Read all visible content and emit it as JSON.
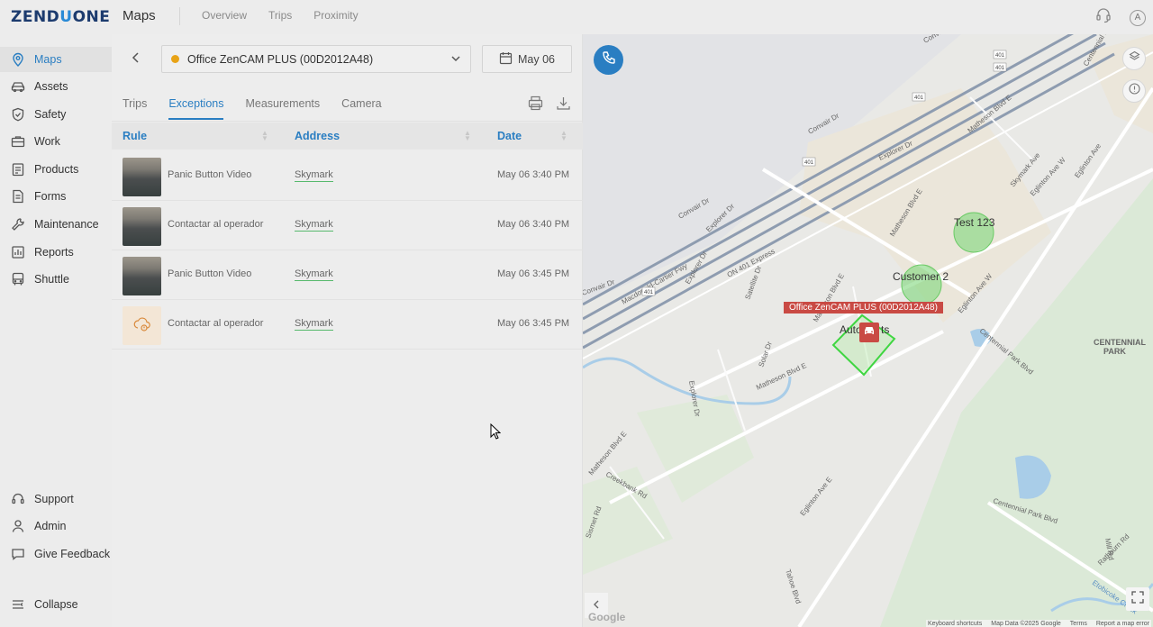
{
  "topbar": {
    "logo_a": "ZEND",
    "logo_b": "U",
    "logo_c": "ONE",
    "title": "Maps",
    "nav": [
      "Overview",
      "Trips",
      "Proximity"
    ],
    "avatar": "A"
  },
  "sidebar": {
    "items": [
      {
        "label": "Maps",
        "icon": "map-pin-icon",
        "active": true
      },
      {
        "label": "Assets",
        "icon": "car-icon"
      },
      {
        "label": "Safety",
        "icon": "shield-icon"
      },
      {
        "label": "Work",
        "icon": "briefcase-icon"
      },
      {
        "label": "Products",
        "icon": "clipboard-icon"
      },
      {
        "label": "Forms",
        "icon": "document-icon"
      },
      {
        "label": "Maintenance",
        "icon": "wrench-icon"
      },
      {
        "label": "Reports",
        "icon": "bar-chart-icon"
      },
      {
        "label": "Shuttle",
        "icon": "bus-icon"
      }
    ],
    "bottom": [
      {
        "label": "Support",
        "icon": "headset-icon"
      },
      {
        "label": "Admin",
        "icon": "person-icon"
      },
      {
        "label": "Give Feedback",
        "icon": "chat-icon"
      }
    ],
    "collapse": "Collapse"
  },
  "panel": {
    "device": "Office ZenCAM PLUS (00D2012A48)",
    "device_status_color": "#e8a317",
    "date": "May 06",
    "tabs": [
      {
        "label": "Trips"
      },
      {
        "label": "Exceptions",
        "active": true
      },
      {
        "label": "Measurements"
      },
      {
        "label": "Camera"
      }
    ],
    "columns": {
      "rule": "Rule",
      "address": "Address",
      "date": "Date"
    },
    "rows": [
      {
        "rule": "Panic Button Video",
        "address": "Skymark",
        "date": "May 06 3:40 PM",
        "thumb": "video"
      },
      {
        "rule": "Contactar al operador",
        "address": "Skymark",
        "date": "May 06 3:40 PM",
        "thumb": "video"
      },
      {
        "rule": "Panic Button Video",
        "address": "Skymark",
        "date": "May 06 3:45 PM",
        "thumb": "video"
      },
      {
        "rule": "Contactar al operador",
        "address": "Skymark",
        "date": "May 06 3:45 PM",
        "thumb": "cloud-alert-icon"
      }
    ]
  },
  "map": {
    "vehicle_label": "Office ZenCAM PLUS (00D2012A48)",
    "zones": [
      "Test 123",
      "Customer 2",
      "Auto",
      "ts"
    ],
    "streets": [
      "Convair Dr",
      "Explorer Dr",
      "Matheson Blvd E",
      "Eglinton Ave W",
      "Eglinton Ave E",
      "Satellite Dr",
      "Solar Dr",
      "Creekbank Rd",
      "Centennial Park Blvd",
      "Skymark Ave",
      "Tahoe Blvd",
      "Sismet Rd",
      "Rathburn Rd",
      "Mill Rd",
      "Etobicoke Creek",
      "Macdonald-Cartier Fwy",
      "ON-401 Express",
      "Centennial Dr"
    ],
    "route_shields": [
      "401"
    ],
    "park": [
      "CENTENNIAL",
      "PARK"
    ],
    "google": "Google",
    "attribution": [
      "Keyboard shortcuts",
      "Map Data ©2025 Google",
      "Terms",
      "Report a map error"
    ],
    "accent": "#2a7ec2",
    "alert_color": "#c94a44"
  }
}
